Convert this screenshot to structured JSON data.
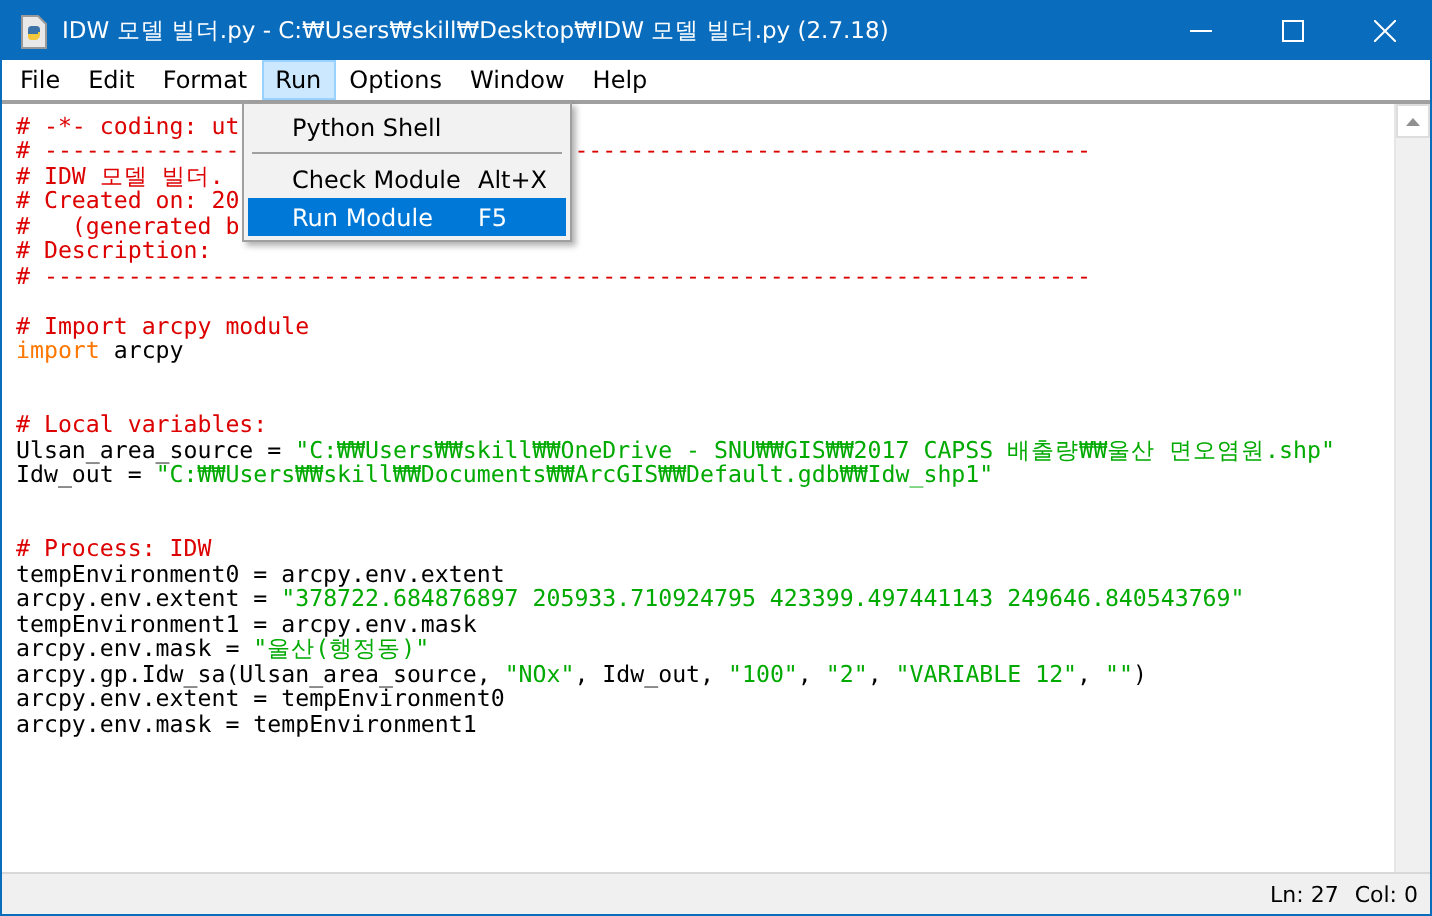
{
  "window": {
    "title": "IDW 모델 빌더.py - C:₩Users₩skill₩Desktop₩IDW 모델 빌더.py (2.7.18)"
  },
  "menu_bar": [
    {
      "label": "File",
      "selected": false
    },
    {
      "label": "Edit",
      "selected": false
    },
    {
      "label": "Format",
      "selected": false
    },
    {
      "label": "Run",
      "selected": true
    },
    {
      "label": "Options",
      "selected": false
    },
    {
      "label": "Window",
      "selected": false
    },
    {
      "label": "Help",
      "selected": false
    }
  ],
  "dropdown": {
    "items": [
      {
        "kind": "item",
        "label": "Python Shell",
        "selected": false
      },
      {
        "kind": "separator"
      },
      {
        "kind": "item",
        "label": "Check Module",
        "shortcut": "Alt+X",
        "selected": false
      },
      {
        "kind": "item",
        "label": "Run Module",
        "shortcut": "F5",
        "selected": true
      }
    ]
  },
  "editor": {
    "lines": [
      {
        "segments": [
          {
            "kind": "comment",
            "text": "# -*- coding: ut"
          }
        ]
      },
      {
        "segments": [
          {
            "kind": "comment",
            "text": "# --------------"
          }
        ],
        "after_menu": [
          {
            "kind": "comment",
            "text": "-------------------------------------"
          }
        ]
      },
      {
        "segments": [
          {
            "kind": "comment",
            "text": "# IDW 모델 빌더."
          }
        ]
      },
      {
        "segments": [
          {
            "kind": "comment",
            "text": "# Created on: 20"
          }
        ]
      },
      {
        "segments": [
          {
            "kind": "comment",
            "text": "#   (generated b"
          }
        ]
      },
      {
        "segments": [
          {
            "kind": "comment",
            "text": "# Description:"
          }
        ]
      },
      {
        "segments": [
          {
            "kind": "comment",
            "text": "# ---------------------------------------------------------------------------"
          }
        ]
      },
      {
        "gap_before": true,
        "segments": [
          {
            "kind": "comment",
            "text": "# Import arcpy module"
          }
        ]
      },
      {
        "segments": [
          {
            "kind": "keyword",
            "text": "import"
          },
          {
            "kind": "plain",
            "text": " arcpy"
          }
        ]
      },
      {
        "section_start": true,
        "segments": [
          {
            "kind": "comment",
            "text": "# Local variables:"
          }
        ]
      },
      {
        "segments": [
          {
            "kind": "plain",
            "text": "Ulsan_area_source = "
          },
          {
            "kind": "string",
            "text": "\"C:₩₩Users₩₩skill₩₩OneDrive - SNU₩₩GIS₩₩2017 CAPSS 배출량₩₩울산 면오염원.shp\""
          }
        ]
      },
      {
        "segments": [
          {
            "kind": "plain",
            "text": "Idw_out = "
          },
          {
            "kind": "string",
            "text": "\"C:₩₩Users₩₩skill₩₩Documents₩₩ArcGIS₩₩Default.gdb₩₩Idw_shp1\""
          }
        ]
      },
      {
        "section_start": true,
        "segments": [
          {
            "kind": "comment",
            "text": "# Process: IDW"
          }
        ]
      },
      {
        "segments": [
          {
            "kind": "plain",
            "text": "tempEnvironment0 = arcpy.env.extent"
          }
        ]
      },
      {
        "segments": [
          {
            "kind": "plain",
            "text": "arcpy.env.extent = "
          },
          {
            "kind": "string",
            "text": "\"378722.684876897 205933.710924795 423399.497441143 249646.840543769\""
          }
        ]
      },
      {
        "segments": [
          {
            "kind": "plain",
            "text": "tempEnvironment1 = arcpy.env.mask"
          }
        ]
      },
      {
        "segments": [
          {
            "kind": "plain",
            "text": "arcpy.env.mask = "
          },
          {
            "kind": "string",
            "text": "\"울산(행정동)\""
          }
        ]
      },
      {
        "segments": [
          {
            "kind": "plain",
            "text": "arcpy.gp.Idw_sa(Ulsan_area_source, "
          },
          {
            "kind": "string",
            "text": "\"NOx\""
          },
          {
            "kind": "plain",
            "text": ", Idw_out, "
          },
          {
            "kind": "string",
            "text": "\"100\""
          },
          {
            "kind": "plain",
            "text": ", "
          },
          {
            "kind": "string",
            "text": "\"2\""
          },
          {
            "kind": "plain",
            "text": ", "
          },
          {
            "kind": "string",
            "text": "\"VARIABLE 12\""
          },
          {
            "kind": "plain",
            "text": ", "
          },
          {
            "kind": "string",
            "text": "\"\""
          },
          {
            "kind": "plain",
            "text": ")"
          }
        ]
      },
      {
        "segments": [
          {
            "kind": "plain",
            "text": "arcpy.env.extent = tempEnvironment0"
          }
        ]
      },
      {
        "segments": [
          {
            "kind": "plain",
            "text": "arcpy.env.mask = tempEnvironment1"
          }
        ]
      }
    ]
  },
  "status_bar": {
    "line": "Ln: 27",
    "column": "Col: 0"
  }
}
